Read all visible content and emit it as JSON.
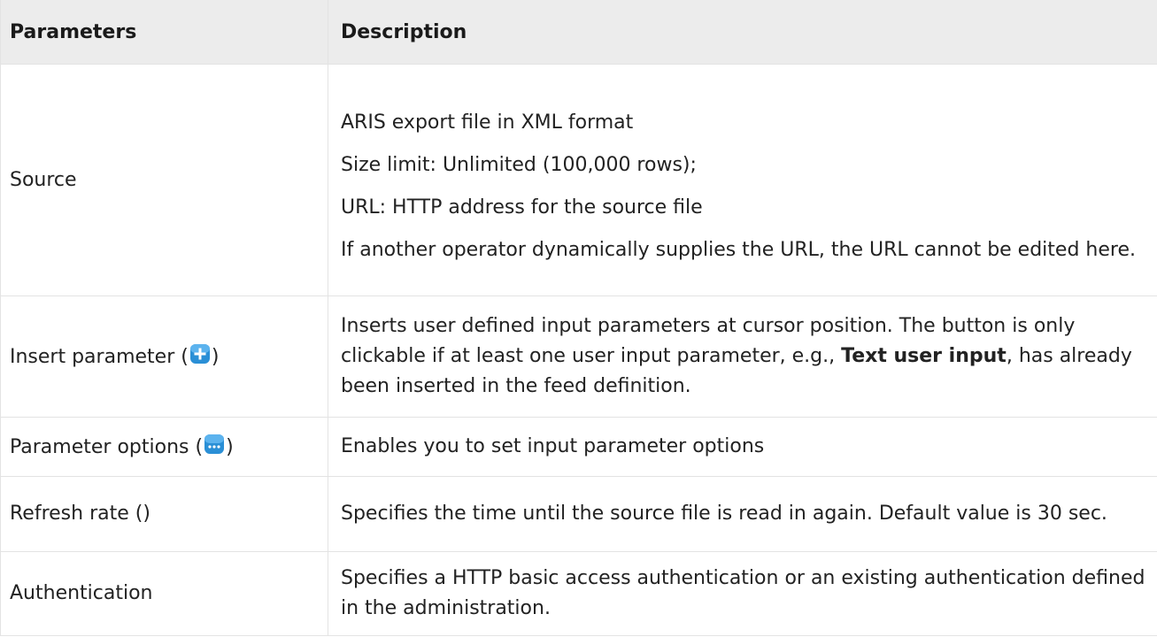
{
  "header": {
    "col1": "Parameters",
    "col2": "Description"
  },
  "rows": {
    "source": {
      "param": "Source",
      "lines": [
        "ARIS export file in XML format",
        "Size limit: Unlimited (100,000 rows);",
        "URL: HTTP address for the source file",
        "If another operator dynamically supplies the URL, the URL cannot be edited here."
      ]
    },
    "insert": {
      "param_prefix": "Insert parameter (",
      "param_suffix": ")",
      "icon": "add-icon",
      "desc_part1": "Inserts user defined input parameters at cursor position. The button is only clickable if at least one user input parameter, e.g., ",
      "desc_bold": "Text user input",
      "desc_part2": ", has already been inserted in the feed definition."
    },
    "options": {
      "param_prefix": "Parameter options (",
      "param_suffix": ")",
      "icon": "more-options-icon",
      "desc": "Enables you to set input parameter options"
    },
    "refresh": {
      "param": "Refresh rate ()",
      "desc": "Specifies the time until the source file is read in again. Default value is 30 sec."
    },
    "auth": {
      "param": "Authentication",
      "desc": "Specifies a HTTP basic access authentication or an existing authentication defined in the administration."
    }
  },
  "colors": {
    "icon_blue": "#2a8fd6",
    "header_bg": "#ececec",
    "border": "#e3e3e3"
  }
}
